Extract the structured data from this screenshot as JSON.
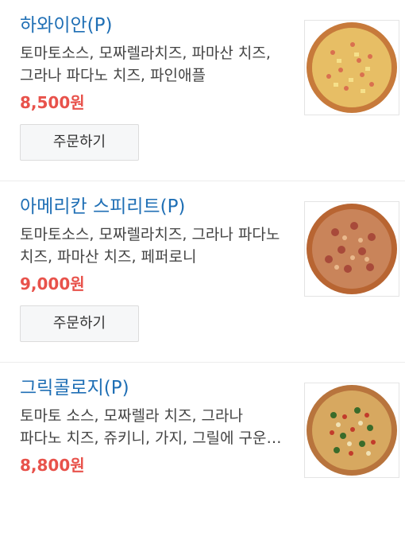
{
  "menu": {
    "items": [
      {
        "name": "하와이안(P)",
        "description": "토마토소스, 모짜렐라치즈, 파마산 치즈, 그라나 파다노 치즈, 파인애플",
        "price": "8,500원",
        "order_label": "주문하기",
        "image_icon": "pizza-hawaiian-image"
      },
      {
        "name": "아메리칸 스피리트(P)",
        "description": "토마토소스, 모짜렐라치즈, 그라나 파다노 치즈, 파마산 치즈, 페퍼로니",
        "price": "9,000원",
        "order_label": "주문하기",
        "image_icon": "pizza-american-spirit-image"
      },
      {
        "name": "그릭콜로지(P)",
        "description": "토마토 소스, 모짜렐라 치즈, 그라나 파다노 치즈, 쥬키니, 가지, 그릴에 구운 야채",
        "price": "8,800원",
        "order_label": "",
        "image_icon": "pizza-greekology-image"
      }
    ]
  },
  "colors": {
    "name": "#1f6fb5",
    "price": "#e8524b",
    "button_bg": "#f6f7f8"
  }
}
